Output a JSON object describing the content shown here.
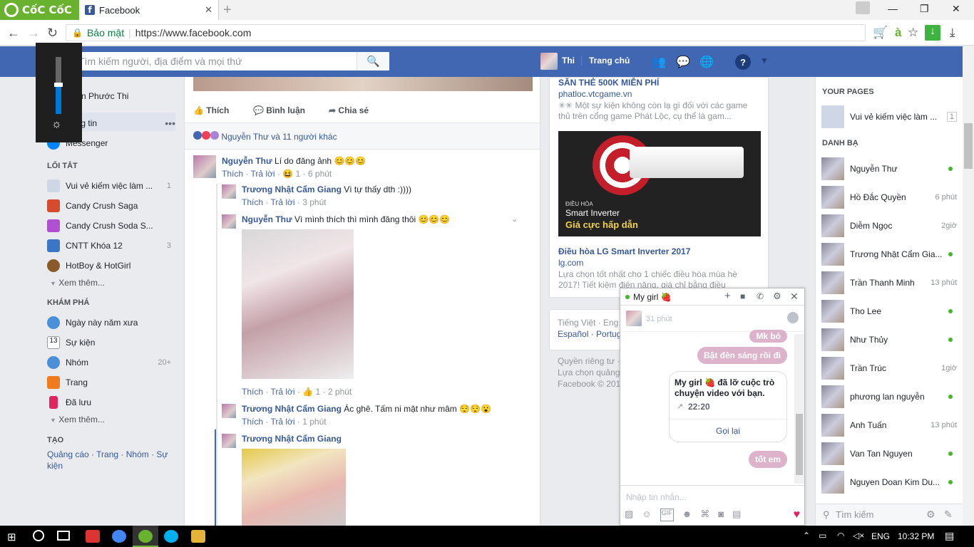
{
  "browser": {
    "brand": "CốC CốC",
    "tab_title": "Facebook",
    "secure_label": "Bảo mật",
    "url": "https://www.facebook.com"
  },
  "fb": {
    "search_placeholder": "Tìm kiếm người, địa điểm và mọi thứ",
    "profile_name": "Thi",
    "home_label": "Trang chủ",
    "brand_color": "#4267b2"
  },
  "left": {
    "profile": "Đoàn Phước Thi",
    "news": "Bảng tin",
    "messenger": "Messenger",
    "shortcuts_head": "LỐI TẮT",
    "shortcuts": [
      {
        "label": "Vui vẻ kiếm việc làm ...",
        "count": "1"
      },
      {
        "label": "Candy Crush Saga",
        "count": ""
      },
      {
        "label": "Candy Crush Soda S...",
        "count": ""
      },
      {
        "label": "CNTT Khóa 12",
        "count": "3"
      },
      {
        "label": "HotBoy & HotGirl",
        "count": ""
      }
    ],
    "see_more": "Xem thêm...",
    "explore_head": "KHÁM PHÁ",
    "explore": [
      {
        "label": "Ngày này năm xưa",
        "count": ""
      },
      {
        "label": "Sự kiện",
        "count": ""
      },
      {
        "label": "Nhóm",
        "count": "20+"
      },
      {
        "label": "Trang",
        "count": ""
      },
      {
        "label": "Đã lưu",
        "count": ""
      }
    ],
    "explore_more": "Xem thêm...",
    "create_head": "TẠO",
    "create_links": "Quảng cáo · Trang · Nhóm · Sự kiện"
  },
  "post": {
    "like": "Thích",
    "comment": "Bình luận",
    "share": "Chia sẻ",
    "reactions": "Nguyễn Thư và 11 người khác",
    "comments": [
      {
        "name": "Nguyễn Thư",
        "text": "Lí do đăng ảnh 😊😊😊",
        "like": "Thích",
        "reply": "Trả lời",
        "count": "1",
        "time": "6 phút"
      },
      {
        "name": "Trương Nhật Cẩm Giang",
        "text": "Vì tự thấy dth :))))",
        "like": "Thích",
        "reply": "Trả lời",
        "count": "",
        "time": "3 phút"
      },
      {
        "name": "Nguyễn Thư",
        "text": "Vì mình thích thì mình đăng thôi 😊😊😊",
        "like": "Thích",
        "reply": "Trả lời",
        "count": "1",
        "time": "2 phút"
      },
      {
        "name": "Trương Nhật Cẩm Giang",
        "text": "Ác ghê. Tấm ni mặt như mâm 😌😌😮",
        "like": "Thích",
        "reply": "Trả lời",
        "count": "",
        "time": "1 phút"
      },
      {
        "name": "Trương Nhật Cẩm Giang",
        "text": "",
        "like": "",
        "reply": "",
        "count": "",
        "time": ""
      }
    ]
  },
  "ads": {
    "ad1_title": "SĂN THẺ 500K MIỄN PHÍ",
    "ad1_domain": "phatloc.vtcgame.vn",
    "ad1_text": "✳✳ Một sự kiện không còn lạ gì đối với các game thủ trên cổng game Phát Lộc, cụ thể là gam...",
    "ad2_img_line1": "ĐIỀU HÒA",
    "ad2_img_line2": "Smart Inverter",
    "ad2_img_line3": "Giá cực hấp dẫn",
    "ad2_title": "Điều hòa LG Smart Inverter 2017",
    "ad2_domain": "lg.com",
    "ad2_text": "Lựa chọn tốt nhất cho 1 chiếc điều hòa mùa hè 2017! Tiết kiệm điện năng, giá chỉ bằng điều",
    "lang1": "Tiếng Việt · Eng",
    "lang2": "Español · Portug",
    "footer1": "Quyền riêng tư ·",
    "footer2": "Lựa chọn quảng",
    "footer3": "Facebook © 201"
  },
  "chatlist": {
    "pages_head": "YOUR PAGES",
    "page_name": "Vui vẻ kiếm việc làm ...",
    "page_count": "1",
    "contacts_head": "DANH BẠ",
    "friends": [
      {
        "name": "Nguyễn Thư",
        "status": "",
        "online": true
      },
      {
        "name": "Hồ Đắc Quyền",
        "status": "6 phút",
        "online": false
      },
      {
        "name": "Diễm Ngọc",
        "status": "2giờ",
        "online": false
      },
      {
        "name": "Trương Nhật Cẩm Gia...",
        "status": "",
        "online": true
      },
      {
        "name": "Trần Thanh Minh",
        "status": "13 phút",
        "online": false
      },
      {
        "name": "Tho Lee",
        "status": "",
        "online": true
      },
      {
        "name": "Như Thủy",
        "status": "",
        "online": true
      },
      {
        "name": "Trần Trúc",
        "status": "1giờ",
        "online": false
      },
      {
        "name": "phương lan nguyễn",
        "status": "",
        "online": true
      },
      {
        "name": "Anh Tuấn",
        "status": "13 phút",
        "online": false
      },
      {
        "name": "Van Tan Nguyen",
        "status": "",
        "online": true
      },
      {
        "name": "Nguyen Doan Kim Du...",
        "status": "",
        "online": true
      }
    ],
    "search_placeholder": "Tìm kiếm"
  },
  "chat": {
    "title": "My girl 🍓",
    "last_seen": "31 phút",
    "msg1": "Mk bó",
    "msg2": "Bật đèn sáng rồi đi",
    "call_text": "My girl 🍓 đã lỡ cuộc trò chuyện video với bạn.",
    "call_time": "22:20",
    "call_back": "Gọi lại",
    "msg3": "tốt em",
    "input_placeholder": "Nhập tin nhắn...",
    "accent": "#ddb3cc"
  },
  "taskbar": {
    "lang": "ENG",
    "time": "10:32 PM"
  }
}
